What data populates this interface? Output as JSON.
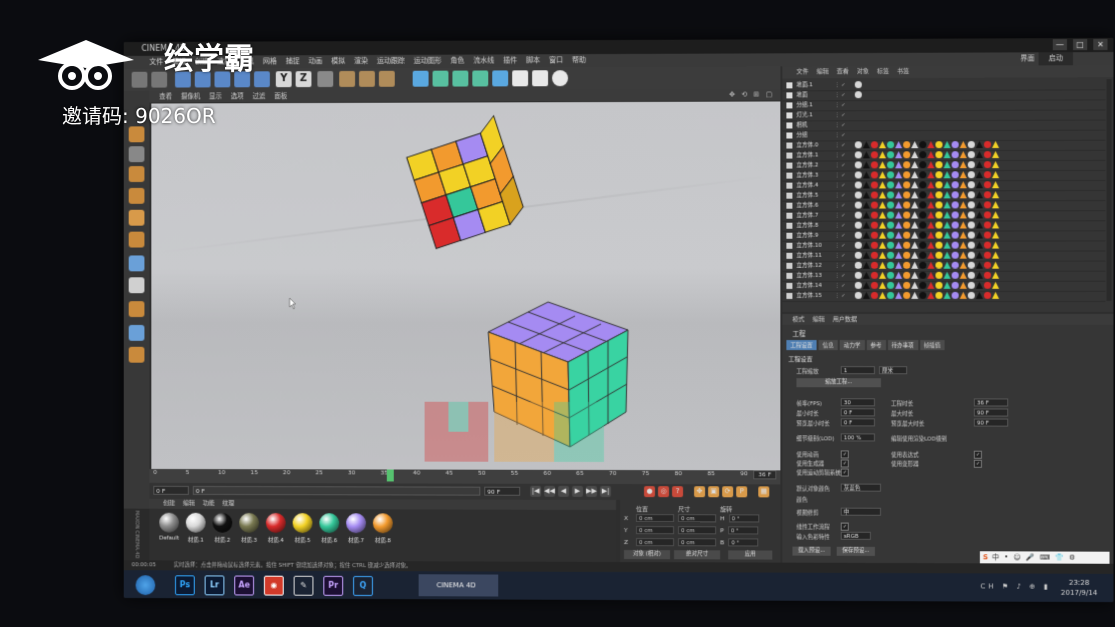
{
  "watermark": {
    "brand": "绘学霸",
    "invite_code": "邀请码: 9026OR"
  },
  "window": {
    "title": "CINEMA 4D",
    "controls": [
      "—",
      "□",
      "✕"
    ]
  },
  "menubar": {
    "items": [
      "文件",
      "编辑",
      "创建",
      "选择",
      "工具",
      "网格",
      "捕捉",
      "动画",
      "模拟",
      "渲染",
      "运动跟踪",
      "运动图形",
      "角色",
      "流水线",
      "插件",
      "脚本",
      "窗口",
      "帮助"
    ],
    "layout_label": "界面",
    "layout_value": "启动"
  },
  "toolbar": {
    "axis_y": "Y",
    "axis_z": "Z"
  },
  "viewport_menu": {
    "items": [
      "查看",
      "摄像机",
      "显示",
      "选项",
      "过滤",
      "面板"
    ],
    "icons": "✥ ⟲ ⊞ ▢"
  },
  "timeline": {
    "ticks": [
      "0",
      "5",
      "10",
      "15",
      "20",
      "25",
      "30",
      "35",
      "40",
      "45",
      "50",
      "55",
      "60",
      "65",
      "70",
      "75",
      "80",
      "85",
      "90"
    ],
    "current_frame": 36,
    "end_label": "36 F",
    "max_frame": 90
  },
  "transport": {
    "start_field": "0 F",
    "end_field": "90 F",
    "range_start": "0 F",
    "range_end": "90 F",
    "buttons": [
      "|◀",
      "◀◀",
      "◀",
      "▶",
      "▶▶",
      "▶|"
    ]
  },
  "material_manager": {
    "menu": [
      "创建",
      "编辑",
      "功能",
      "纹理"
    ],
    "maxon_label": "MAXON CINEMA 4D",
    "materials": [
      {
        "label": "Default",
        "color": "#8e8e8e"
      },
      {
        "label": "材质.1",
        "color": "#d9d9d9"
      },
      {
        "label": "材质.2",
        "color": "#111111"
      },
      {
        "label": "材质.3",
        "color": "#7a7a52"
      },
      {
        "label": "材质.4",
        "color": "#d92b2b"
      },
      {
        "label": "材质.5",
        "color": "#f2d125"
      },
      {
        "label": "材质.6",
        "color": "#35c79a"
      },
      {
        "label": "材质.7",
        "color": "#a58bf2"
      },
      {
        "label": "材质.8",
        "color": "#f29a2e"
      }
    ]
  },
  "coordinates": {
    "headers": [
      "位置",
      "尺寸",
      "旋转"
    ],
    "rows": [
      {
        "axis": "X",
        "pos": "0 cm",
        "size": "0 cm",
        "rot_axis": "H",
        "rot": "0 °"
      },
      {
        "axis": "Y",
        "pos": "0 cm",
        "size": "0 cm",
        "rot_axis": "P",
        "rot": "0 °"
      },
      {
        "axis": "Z",
        "pos": "0 cm",
        "size": "0 cm",
        "rot_axis": "B",
        "rot": "0 °"
      }
    ],
    "mode_select": "对象 (相对)",
    "size_select": "绝对尺寸",
    "apply_button": "应用"
  },
  "status_bar": {
    "time": "00:00:05",
    "message": "实时选择：点击并拖动鼠标选择元素。按住 SHIFT 键增加选择对象；按住 CTRL 键减少选择对象。"
  },
  "object_manager": {
    "menu": [
      "文件",
      "编辑",
      "查看",
      "对象",
      "标签",
      "书签"
    ],
    "rows": [
      {
        "name": "地面.1",
        "tags": 1
      },
      {
        "name": "地面",
        "tags": 1
      },
      {
        "name": "分组.1",
        "tags": 0
      },
      {
        "name": "灯光.1",
        "tags": 0
      },
      {
        "name": "相机",
        "tags": 0
      },
      {
        "name": "分组",
        "tags": 0
      },
      {
        "name": "立方体.0",
        "tags": 18
      },
      {
        "name": "立方体.1",
        "tags": 18
      },
      {
        "name": "立方体.2",
        "tags": 18
      },
      {
        "name": "立方体.3",
        "tags": 18
      },
      {
        "name": "立方体.4",
        "tags": 18
      },
      {
        "name": "立方体.5",
        "tags": 18
      },
      {
        "name": "立方体.6",
        "tags": 18
      },
      {
        "name": "立方体.7",
        "tags": 18
      },
      {
        "name": "立方体.8",
        "tags": 18
      },
      {
        "name": "立方体.9",
        "tags": 18
      },
      {
        "name": "立方体.10",
        "tags": 18
      },
      {
        "name": "立方体.11",
        "tags": 18
      },
      {
        "name": "立方体.12",
        "tags": 18
      },
      {
        "name": "立方体.13",
        "tags": 18
      },
      {
        "name": "立方体.14",
        "tags": 18
      },
      {
        "name": "立方体.15",
        "tags": 18
      }
    ],
    "tag_colors": [
      "#d8d8d8",
      "#111111",
      "#d92b2b",
      "#f2d125",
      "#35c79a",
      "#a58bf2",
      "#f29a2e"
    ]
  },
  "attribute_manager": {
    "menu": [
      "模式",
      "编辑",
      "用户数据"
    ],
    "title": "工程",
    "tabs": [
      "工程设置",
      "信息",
      "动力学",
      "参考",
      "待办事项",
      "帧插值"
    ],
    "section": "工程设置",
    "scale_label": "工程缩放",
    "scale_value": "1",
    "scale_unit": "厘米",
    "scale_button": "缩放工程...",
    "fields": [
      {
        "label": "帧率(FPS)",
        "value": "30",
        "label2": "工程时长",
        "value2": "36 F"
      },
      {
        "label": "最小时长",
        "value": "0 F",
        "label2": "最大时长",
        "value2": "90 F"
      },
      {
        "label": "预览最小时长",
        "value": "0 F",
        "label2": "预览最大时长",
        "value2": "90 F"
      }
    ],
    "lod_label": "细节级别(LOD)",
    "lod_value": "100 %",
    "lod_check_label": "编辑使用渲染LOD级别",
    "checks": [
      {
        "label": "使用动画",
        "label2": "使用表达式"
      },
      {
        "label": "使用生成器",
        "label2": "使用变形器"
      },
      {
        "label": "使用运动剪辑系统",
        "label2": ""
      }
    ],
    "default_color_label": "默认对象颜色",
    "default_color_value": "灰蓝色",
    "color_label": "颜色",
    "view_clip_label": "视图修剪",
    "view_clip_value": "中",
    "linear_label": "线性工作流程",
    "input_color_label": "输入色彩特性",
    "input_color_value": "sRGB",
    "load_button": "载入预设...",
    "save_button": "保存预设..."
  },
  "taskbar": {
    "apps": [
      {
        "label": "Ps",
        "bg": "#0b1a33",
        "fg": "#31a8ff"
      },
      {
        "label": "Lr",
        "bg": "#0b1a33",
        "fg": "#8fd1ff"
      },
      {
        "label": "Ae",
        "bg": "#1c0f33",
        "fg": "#c7a4ff"
      },
      {
        "label": "◉",
        "bg": "#d23a2a",
        "fg": "#ffffff"
      },
      {
        "label": "✎",
        "bg": "#1a2333",
        "fg": "#dddddd"
      },
      {
        "label": "Pr",
        "bg": "#1c0f33",
        "fg": "#c7a4ff"
      },
      {
        "label": "Q",
        "bg": "#1a2333",
        "fg": "#3fa9ff"
      }
    ],
    "active_window": "CINEMA 4D",
    "tray": "CH ⚑ ♪ ⊕ ▮",
    "time": "23:28",
    "date": "2017/9/14"
  },
  "ime": {
    "brand": "S",
    "items": [
      "中",
      "•",
      "☺",
      "🎤",
      "⌨",
      "👕",
      "⚙"
    ]
  }
}
